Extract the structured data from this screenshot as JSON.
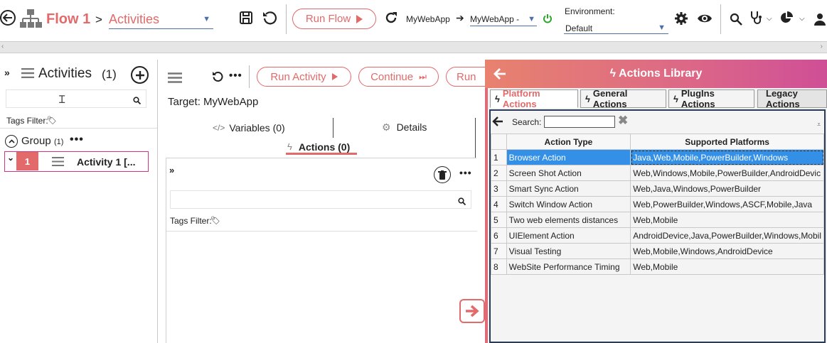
{
  "toolbar": {
    "flow_title": "Flow 1",
    "breadcrumb_sep": ">",
    "activities_select": "Activities",
    "run_flow_label": "Run Flow",
    "app_label": "MyWebApp",
    "app_target": "MyWebApp -",
    "environment_label": "Environment:",
    "environment_value": "Default"
  },
  "left": {
    "title": "Activities",
    "count": "(1)",
    "search_placeholder": "",
    "tags_filter": "Tags Filter:",
    "group_label": "Group",
    "group_count": "(1)",
    "activity_number": "1",
    "activity_name": "Activity 1 [..."
  },
  "middle": {
    "run_activity_label": "Run Activity",
    "continue_label": "Continue",
    "run_label": "Run",
    "target": "Target: MyWebApp",
    "variables_tab": "Variables (0)",
    "details_tab": "Details",
    "actions_tab": "Actions (0)",
    "tags_filter": "Tags Filter:"
  },
  "library": {
    "title": "Actions Library",
    "tabs": [
      "Platform Actions",
      "General Actions",
      "PlugIns Actions",
      "Legacy Actions"
    ],
    "search_label": "Search:",
    "columns": [
      "Action Type",
      "Supported Platforms"
    ],
    "rows": [
      {
        "n": "1",
        "type": "Browser Action",
        "platforms": "Java,Web,Mobile,PowerBuilder,Windows"
      },
      {
        "n": "2",
        "type": "Screen Shot Action",
        "platforms": "Web,Windows,Mobile,PowerBuilder,AndroidDevic"
      },
      {
        "n": "3",
        "type": "Smart Sync Action",
        "platforms": "Web,Java,Windows,PowerBuilder"
      },
      {
        "n": "4",
        "type": "Switch Window Action",
        "platforms": "Web,PowerBuilder,Windows,ASCF,Mobile,Java"
      },
      {
        "n": "5",
        "type": "Two web elements distances",
        "platforms": "Web,Mobile"
      },
      {
        "n": "6",
        "type": "UIElement Action",
        "platforms": "AndroidDevice,Java,PowerBuilder,Windows,Mobil"
      },
      {
        "n": "7",
        "type": "Visual Testing",
        "platforms": "Web,Mobile,Windows,AndroidDevice"
      },
      {
        "n": "8",
        "type": "WebSite Performance Timing",
        "platforms": "Web,Mobile"
      }
    ],
    "selected_row": 0
  },
  "colors": {
    "accent": "#e26a6a",
    "link_blue": "#4d6fa8",
    "selection": "#3390e6",
    "power_green": "#2aa52a"
  }
}
